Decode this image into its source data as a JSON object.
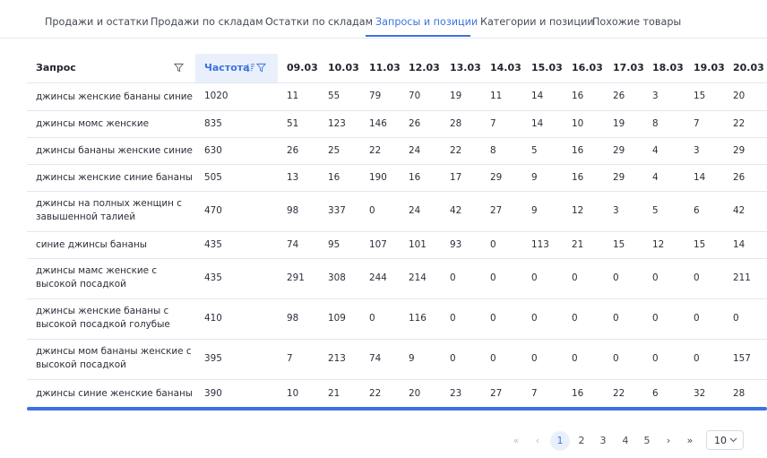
{
  "tabs": [
    {
      "label": "Продажи и остатки",
      "active": false
    },
    {
      "label": "Продажи по складам",
      "active": false
    },
    {
      "label": "Остатки по складам",
      "active": false
    },
    {
      "label": "Запросы и позиции",
      "active": true
    },
    {
      "label": "Категории и позиции",
      "active": false
    },
    {
      "label": "Похожие товары",
      "active": false
    }
  ],
  "table": {
    "header_query": "Запрос",
    "header_freq": "Частота",
    "dates": [
      "09.03",
      "10.03",
      "11.03",
      "12.03",
      "13.03",
      "14.03",
      "15.03",
      "16.03",
      "17.03",
      "18.03",
      "19.03",
      "20.03"
    ],
    "rows": [
      {
        "query": "джинсы женские бананы синие",
        "freq": "1020",
        "values": [
          "11",
          "55",
          "79",
          "70",
          "19",
          "11",
          "14",
          "16",
          "26",
          "3",
          "15",
          "20"
        ]
      },
      {
        "query": "джинсы момс женские",
        "freq": "835",
        "values": [
          "51",
          "123",
          "146",
          "26",
          "28",
          "7",
          "14",
          "10",
          "19",
          "8",
          "7",
          "22"
        ]
      },
      {
        "query": "джинсы бананы женские синие",
        "freq": "630",
        "values": [
          "26",
          "25",
          "22",
          "24",
          "22",
          "8",
          "5",
          "16",
          "29",
          "4",
          "3",
          "29"
        ]
      },
      {
        "query": "джинсы женские синие бананы",
        "freq": "505",
        "values": [
          "13",
          "16",
          "190",
          "16",
          "17",
          "29",
          "9",
          "16",
          "29",
          "4",
          "14",
          "26"
        ]
      },
      {
        "query": "джинсы на полных женщин с завышенной талией",
        "freq": "470",
        "values": [
          "98",
          "337",
          "0",
          "24",
          "42",
          "27",
          "9",
          "12",
          "3",
          "5",
          "6",
          "42"
        ]
      },
      {
        "query": "синие джинсы бананы",
        "freq": "435",
        "values": [
          "74",
          "95",
          "107",
          "101",
          "93",
          "0",
          "113",
          "21",
          "15",
          "12",
          "15",
          "14"
        ]
      },
      {
        "query": "джинсы мамс женские с высокой посадкой",
        "freq": "435",
        "values": [
          "291",
          "308",
          "244",
          "214",
          "0",
          "0",
          "0",
          "0",
          "0",
          "0",
          "0",
          "211"
        ]
      },
      {
        "query": "джинсы женские бананы с высокой посадкой голубые",
        "freq": "410",
        "values": [
          "98",
          "109",
          "0",
          "116",
          "0",
          "0",
          "0",
          "0",
          "0",
          "0",
          "0",
          "0"
        ]
      },
      {
        "query": "джинсы мом бананы женские с высокой посадкой",
        "freq": "395",
        "values": [
          "7",
          "213",
          "74",
          "9",
          "0",
          "0",
          "0",
          "0",
          "0",
          "0",
          "0",
          "157"
        ]
      },
      {
        "query": "джинсы синие женские бананы",
        "freq": "390",
        "values": [
          "10",
          "21",
          "22",
          "20",
          "23",
          "27",
          "7",
          "16",
          "22",
          "6",
          "32",
          "28"
        ]
      }
    ]
  },
  "pagination": {
    "first": "«",
    "prev": "‹",
    "pages": [
      "1",
      "2",
      "3",
      "4",
      "5"
    ],
    "current": "1",
    "next": "›",
    "last": "»",
    "page_size": "10"
  },
  "colors": {
    "accent": "#3b73e0",
    "header_highlight": "#e9f0fb"
  }
}
